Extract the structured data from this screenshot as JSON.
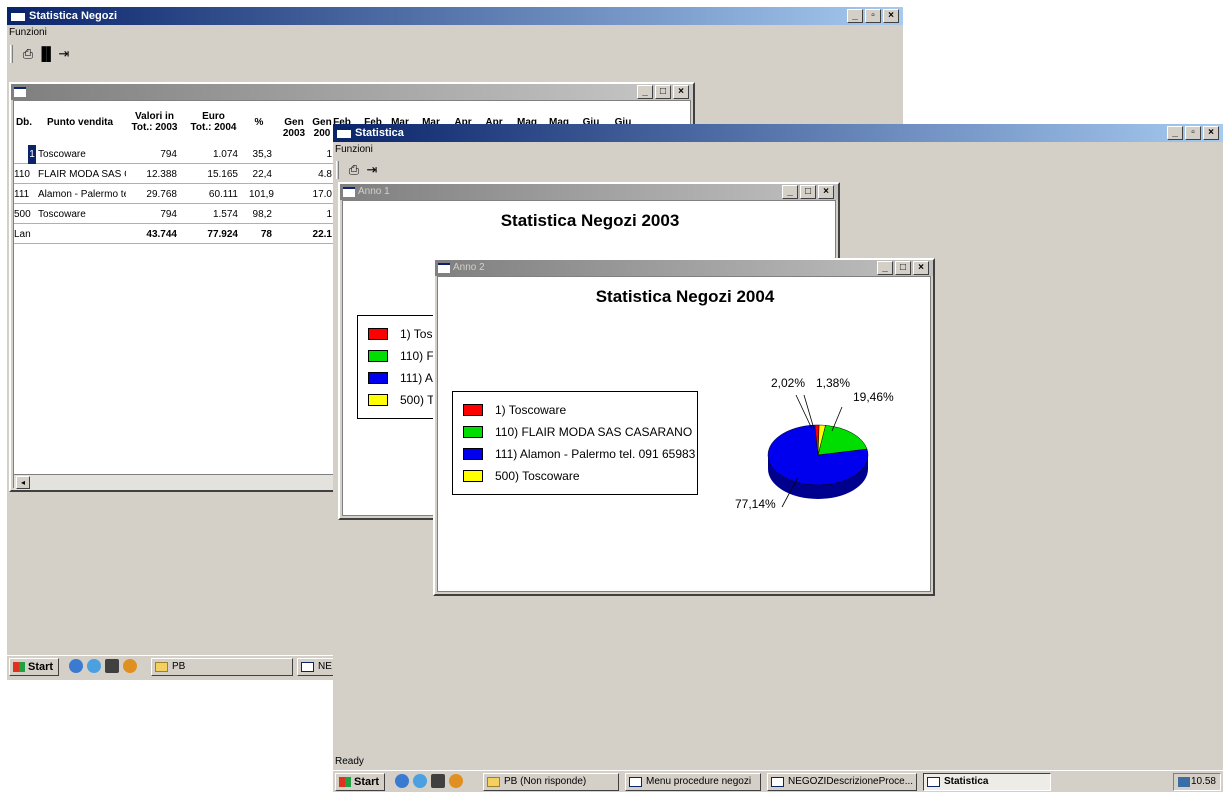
{
  "back_window": {
    "title": "Statistica Negozi",
    "menu": "Funzioni",
    "toolbar_icons": [
      "printer-icon",
      "bar-chart-icon",
      "exit-icon"
    ],
    "child": {
      "columns": [
        {
          "label": "Db."
        },
        {
          "label": "Punto vendita"
        },
        {
          "label": "Valori in\nTot.: 2003"
        },
        {
          "label": "Euro\nTot.: 2004"
        },
        {
          "label": "%"
        },
        {
          "label": "Gen\n2003"
        },
        {
          "label": "Gen\n200"
        },
        {
          "label": "Feb"
        },
        {
          "label": "Feb"
        },
        {
          "label": "Mar"
        },
        {
          "label": "Mar"
        },
        {
          "label": "Apr"
        },
        {
          "label": "Apr"
        },
        {
          "label": "Mag"
        },
        {
          "label": "Mag"
        },
        {
          "label": "Giu"
        },
        {
          "label": "Giu"
        }
      ],
      "rows": [
        {
          "db": "1",
          "name": "Toscoware",
          "tot2003": "794",
          "tot2004": "1.074",
          "pct": "35,3",
          "gen2003": "",
          "gen2004": "1"
        },
        {
          "db": "110",
          "name": "FLAIR MODA SAS C/",
          "tot2003": "12.388",
          "tot2004": "15.165",
          "pct": "22,4",
          "gen2003": "",
          "gen2004": "4.8"
        },
        {
          "db": "111",
          "name": "Alamon - Palermo tel.",
          "tot2003": "29.768",
          "tot2004": "60.111",
          "pct": "101,9",
          "gen2003": "",
          "gen2004": "17.0"
        },
        {
          "db": "500",
          "name": "Toscoware",
          "tot2003": "794",
          "tot2004": "1.574",
          "pct": "98,2",
          "gen2003": "",
          "gen2004": "1"
        }
      ],
      "total_row": {
        "db": "Lan",
        "tot2003": "43.744",
        "tot2004": "77.924",
        "pct": "78",
        "gen2004": "22.1"
      }
    },
    "taskbar": {
      "start": "Start",
      "buttons": [
        "PB",
        "NE"
      ]
    }
  },
  "front_window": {
    "title": "Statistica",
    "menu": "Funzioni",
    "toolbar_icons": [
      "printer-icon",
      "exit-icon"
    ],
    "status": "Ready",
    "anno1": {
      "title": "Anno 1",
      "chart_title": "Statistica Negozi 2003",
      "legend_visible": [
        "1) Tos",
        "110) F",
        "111) A",
        "500) T"
      ]
    },
    "anno2": {
      "title": "Anno 2",
      "chart_data": {
        "type": "pie",
        "title": "Statistica Negozi 2004",
        "categories": [
          "1) Toscoware",
          "110) FLAIR MODA SAS CASARANO",
          "111) Alamon - Palermo tel. 091 65983",
          "500) Toscoware"
        ],
        "values": [
          1.38,
          19.46,
          77.14,
          2.02
        ],
        "value_labels": [
          "1,38%",
          "19,46%",
          "77,14%",
          "2,02%"
        ],
        "colors": [
          "#ff0000",
          "#00dd00",
          "#0000ee",
          "#ffff00"
        ],
        "legend": "left",
        "style": "3d"
      }
    },
    "taskbar": {
      "start": "Start",
      "buttons": [
        {
          "label": "PB (Non risponde)",
          "active": false
        },
        {
          "label": "Menu procedure negozi",
          "active": false
        },
        {
          "label": "NEGOZIDescrizioneProce...",
          "active": false
        },
        {
          "label": "Statistica",
          "active": true
        }
      ],
      "clock": "10.58"
    }
  },
  "colors": {
    "active_title": "#0a246a",
    "face": "#d4d0c8"
  }
}
